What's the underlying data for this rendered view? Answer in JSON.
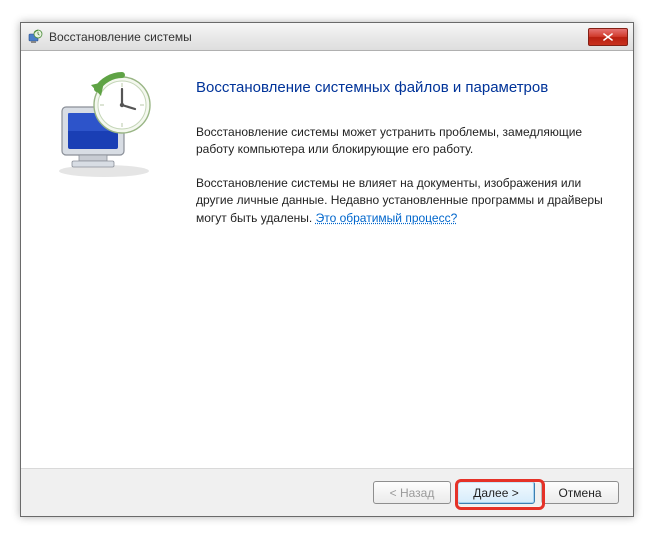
{
  "window": {
    "title": "Восстановление системы"
  },
  "main": {
    "heading": "Восстановление системных файлов и параметров",
    "para1": "Восстановление системы может устранить проблемы, замедляющие работу компьютера или блокирующие его работу.",
    "para2a": "Восстановление системы не влияет на документы, изображения или другие личные данные. Недавно установленные программы и драйверы могут быть удалены. ",
    "link": "Это обратимый процесс?"
  },
  "footer": {
    "back": "< Назад",
    "next": "Далее >",
    "cancel": "Отмена"
  }
}
